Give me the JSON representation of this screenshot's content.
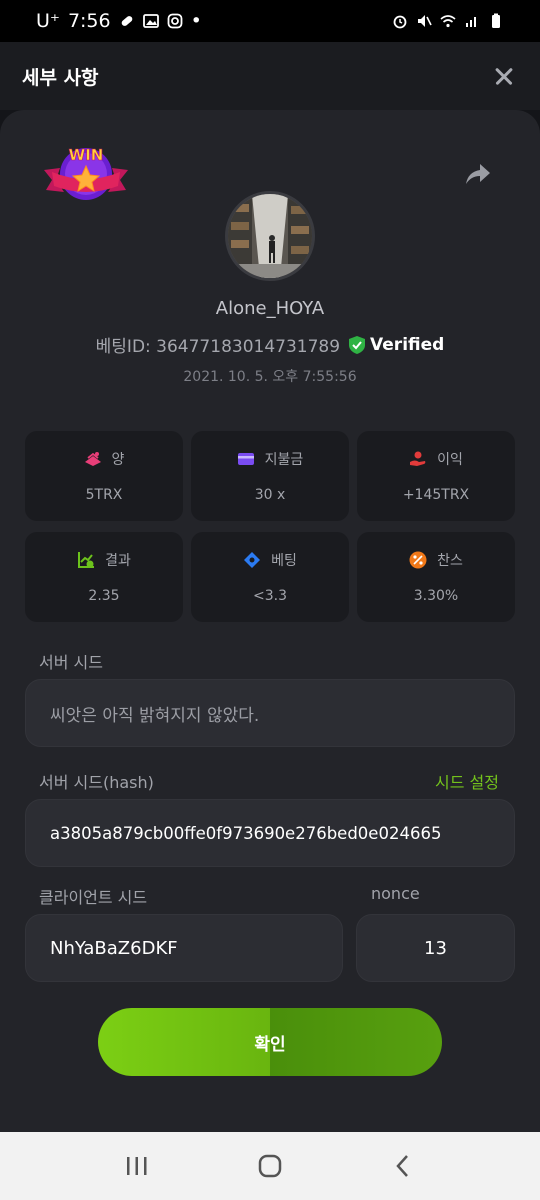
{
  "status_bar": {
    "carrier": "U⁺",
    "time": "7:56",
    "dot": "•"
  },
  "header": {
    "title": "세부 사항"
  },
  "badge": {
    "text": "WIN"
  },
  "profile": {
    "username": "Alone_HOYA",
    "bet_id": "베팅ID: 36477183014731789",
    "verified": "Verified",
    "datetime": "2021. 10. 5. 오후 7:55:56"
  },
  "stats": [
    {
      "label": "양",
      "value": "5TRX",
      "icon": "money-stack-icon",
      "color": "#e83e78"
    },
    {
      "label": "지불금",
      "value": "30 x",
      "icon": "wallet-icon",
      "color": "#7a4cf2"
    },
    {
      "label": "이익",
      "value": "+145TRX",
      "icon": "hand-coin-icon",
      "color": "#e23b3b"
    },
    {
      "label": "결과",
      "value": "2.35",
      "icon": "chart-check-icon",
      "color": "#6cc21c"
    },
    {
      "label": "베팅",
      "value": "<3.3",
      "icon": "ticket-icon",
      "color": "#2b7bf2"
    },
    {
      "label": "찬스",
      "value": "3.30%",
      "icon": "percent-icon",
      "color": "#f07818"
    }
  ],
  "server_seed": {
    "label": "서버 시드",
    "value": "씨앗은 아직 밝혀지지 않았다."
  },
  "server_seed_hash": {
    "label": "서버 시드(hash)",
    "link": "시드 설정",
    "value": "a3805a879cb00ffe0f973690e276bed0e024665"
  },
  "client_seed": {
    "label": "클라이언트 시드",
    "value": "NhYaBaZ6DKF"
  },
  "nonce": {
    "label": "nonce",
    "value": "13"
  },
  "confirm_button": "확인",
  "colors": {
    "accent_green": "#73c21c",
    "verified_green": "#2fb344",
    "background": "#232429"
  }
}
